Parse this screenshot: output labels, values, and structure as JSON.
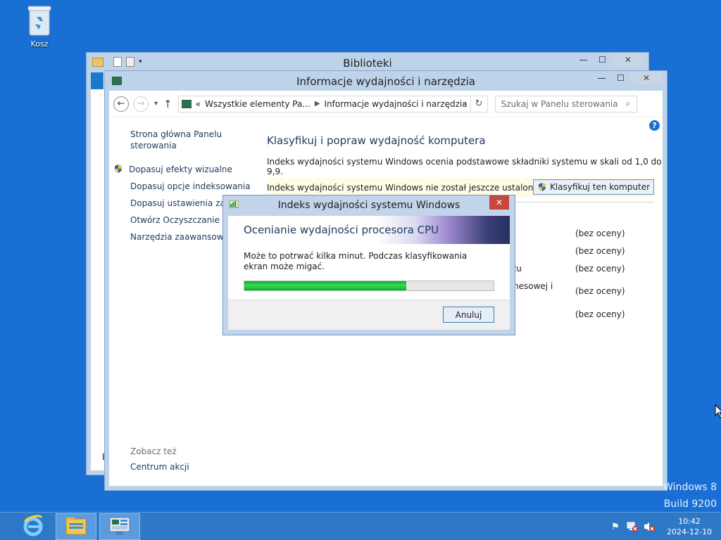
{
  "desktop": {
    "recycle_bin_label": "Kosz"
  },
  "back_window": {
    "title": "Biblioteki",
    "side_letter": "B"
  },
  "window": {
    "title": "Informacje wydajności i narzędzia",
    "address": {
      "prefix": "«",
      "crumbs": [
        "Wszystkie elementy Pa...",
        "Informacje wydajności i narzędzia"
      ]
    },
    "search_placeholder": "Szukaj w Panelu sterowania",
    "sidebar": {
      "home": "Strona główna Panelu sterowania",
      "items": [
        "Dopasuj efekty wizualne",
        "Dopasuj opcje indeksowania",
        "Dopasuj ustawienia zasila",
        "Otwórz Oczyszczanie dys",
        "Narzędzia zaawansowane"
      ],
      "see_also_heading": "Zobacz też",
      "see_also_link": "Centrum akcji"
    },
    "main": {
      "title": "Klasyfikuj i popraw wydajność komputera",
      "description": "Indeks wydajności systemu Windows ocenia podstawowe składniki systemu w skali od 1,0 do 9,9.",
      "notice": "Indeks wydajności systemu Windows nie został jeszcze ustalony.",
      "classify_button": "Klasyfikuj ten komputer",
      "partial_labels": [
        "zu",
        "nesowej i"
      ],
      "scores": [
        "(bez oceny)",
        "(bez oceny)",
        "(bez oceny)",
        "(bez oceny)",
        "(bez oceny)"
      ]
    }
  },
  "dialog": {
    "title": "Indeks wydajności systemu Windows",
    "close_label": "✕",
    "heading": "Ocenianie wydajności procesora CPU",
    "message_line1": "Może to potrwać kilka minut. Podczas klasyfikowania",
    "message_line2": "ekran może migać.",
    "progress_fraction": 0.65,
    "cancel_button": "Anuluj"
  },
  "watermark": {
    "line1": "Windows 8",
    "line2": "Build 9200"
  },
  "taskbar": {
    "time": "10:42",
    "date": "2024-12-10"
  },
  "colors": {
    "accent": "#1a6fd4",
    "progress": "#06b025",
    "close": "#c7473f"
  }
}
